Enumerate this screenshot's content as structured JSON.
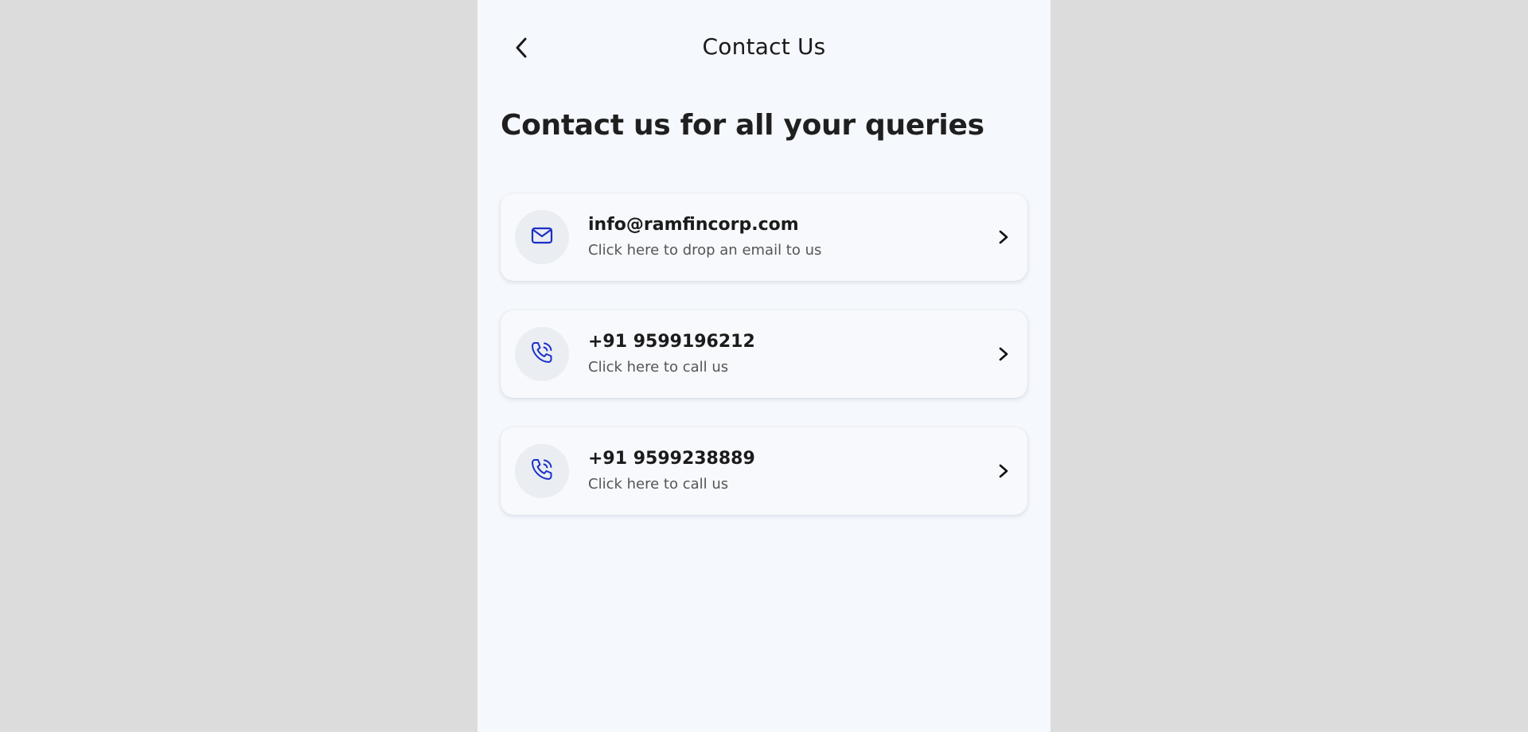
{
  "header": {
    "title": "Contact Us",
    "back_icon": "chevron-left-icon"
  },
  "headline": "Contact us for all your queries",
  "accent_color": "#1a2fc9",
  "contacts": [
    {
      "icon": "mail-icon",
      "title": "info@ramfincorp.com",
      "subtitle": "Click here to drop an email to us"
    },
    {
      "icon": "phone-call-icon",
      "title": "+91 9599196212",
      "subtitle": "Click here to call us"
    },
    {
      "icon": "phone-call-icon",
      "title": "+91 9599238889",
      "subtitle": "Click here to call us"
    }
  ]
}
